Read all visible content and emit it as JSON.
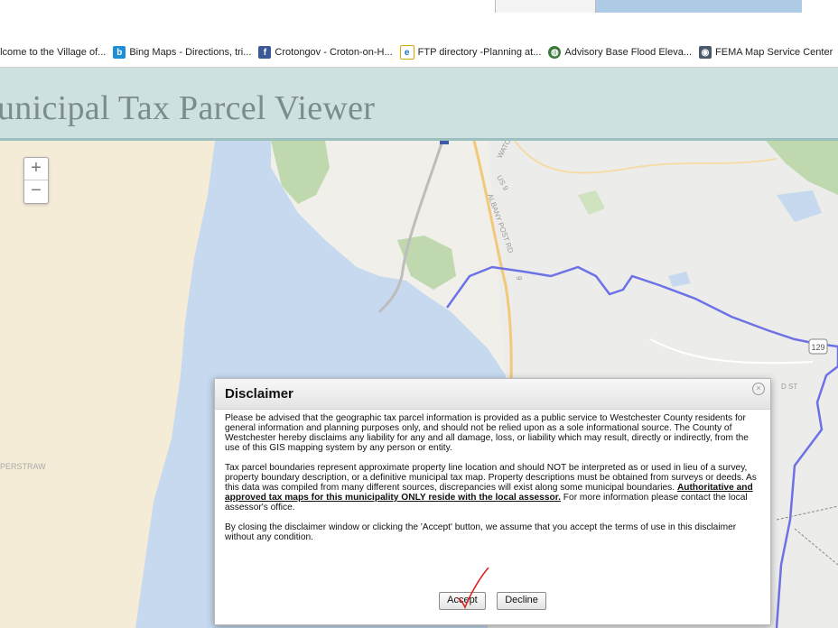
{
  "bookmarks": [
    {
      "label": "elcome to the Village of...",
      "icon": "village-icon",
      "color": "#ffffff"
    },
    {
      "label": "Bing Maps - Directions, tri...",
      "icon": "bing-icon",
      "color": "#1e8fd6"
    },
    {
      "label": "Crotongov - Croton-on-H...",
      "icon": "facebook-icon",
      "color": "#3b5998"
    },
    {
      "label": "FTP directory -Planning at...",
      "icon": "ie-page-icon",
      "color": "#f0c040"
    },
    {
      "label": "Advisory Base Flood Eleva...",
      "icon": "globe-icon",
      "color": "#3a7a3a"
    },
    {
      "label": "FEMA Map Service Center",
      "icon": "fema-icon",
      "color": "#4a5a6a"
    }
  ],
  "app": {
    "title": "unicipal Tax Parcel Viewer"
  },
  "map": {
    "zoom_in": "+",
    "zoom_out": "−",
    "labels": {
      "road_us9": "US 9",
      "albany_post": "ALBANY POST RD",
      "watch_hill": "WATCH HILL RD",
      "route": "129",
      "place": "PERSTRAW",
      "street_suffix": "D ST",
      "road_9a": "9"
    }
  },
  "dialog": {
    "title": "Disclaimer",
    "paragraph1": "Please be advised that the geographic tax parcel information is provided as a public service to Westchester County residents for general information and planning purposes only, and should not be relied upon as a sole informational source. The County of Westchester hereby disclaims any liability for any and all damage, loss, or liability which may result, directly or indirectly, from the use of this GIS mapping system by any person or entity.",
    "paragraph2_start": "Tax parcel boundaries represent approximate property line location and should NOT be interpreted as or used in lieu of a survey, property boundary description, or a definitive municipal tax map. Property descriptions must be obtained from surveys or deeds. As this data was compiled from many different sources, discrepancies will exist along some municipal boundaries. ",
    "paragraph2_bold": "Authoritative and approved tax maps for this municipality ONLY reside with the local assessor.",
    "paragraph2_end": " For more information please contact the local assessor's office.",
    "paragraph3": "By closing the disclaimer window or clicking the 'Accept' button, we assume that you accept the terms of use in this disclaimer without any condition.",
    "accept_label": "Accept",
    "decline_label": "Decline"
  }
}
